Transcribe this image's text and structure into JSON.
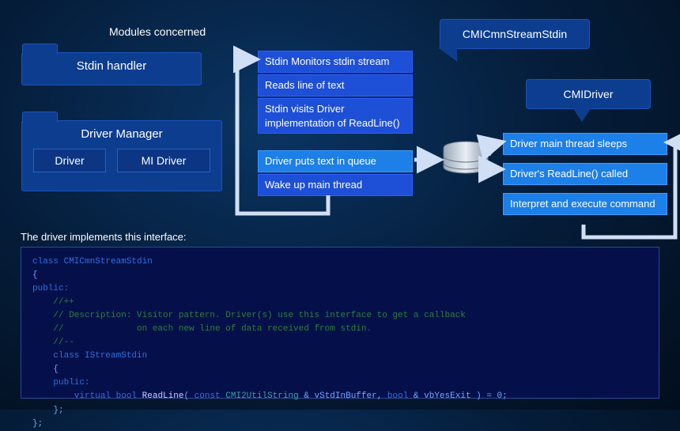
{
  "modules_label": "Modules concerned",
  "folder1": {
    "title": "Stdin handler"
  },
  "folder2": {
    "title": "Driver Manager",
    "child1": "Driver",
    "child2": "MI Driver"
  },
  "callout_left": "CMICmnStreamStdin",
  "callout_right": "CMIDriver",
  "left_flow": {
    "b1": "Stdin Monitors stdin stream",
    "b2": "Reads line of text",
    "b3": "Stdin visits Driver implementation of ReadLine()",
    "b4": "Driver puts text in queue",
    "b5": "Wake up main thread"
  },
  "right_flow": {
    "b1": "Driver main thread sleeps",
    "b2": "Driver's ReadLine() called",
    "b3": "Interpret and execute command"
  },
  "interface_label": "The driver implements this interface:",
  "code": {
    "l1": "class CMICmnStreamStdin",
    "l2": "{",
    "l3": "public:",
    "l4": "    //++",
    "l5": "    // Description: Visitor pattern. Driver(s) use this interface to get a callback",
    "l6": "    //              on each new line of data received from stdin.",
    "l7": "    //--",
    "l8": "    class IStreamStdin",
    "l9": "    {",
    "l10": "    public:",
    "l11_a": "        virtual",
    "l11_b": " bool ",
    "l11_c": "ReadLine",
    "l11_d": "( ",
    "l11_e": "const",
    "l11_f": " CMI2UtilString ",
    "l11_g": "& vStdInBuffer, ",
    "l11_h": "bool",
    "l11_i": " & vbYesExit ) = 0;",
    "l12": "    };",
    "l13": "};"
  }
}
